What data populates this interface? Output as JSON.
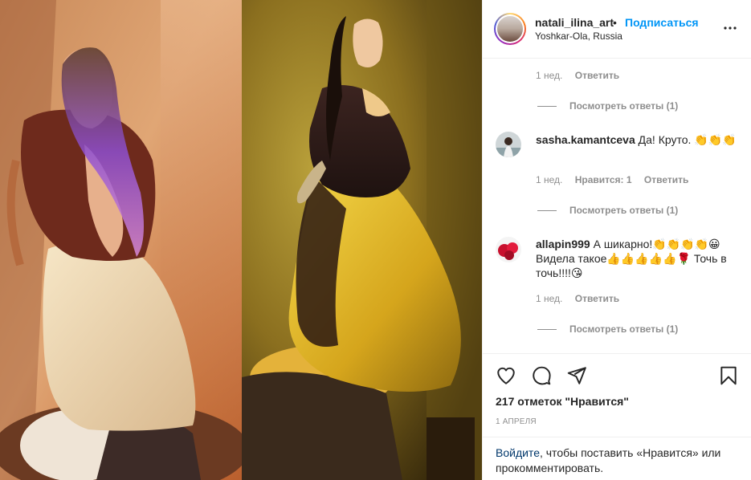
{
  "post": {
    "username": "natali_ilina_art",
    "separator": "•",
    "follow_label": "Подписаться",
    "location": "Yoshkar-Ola, Russia",
    "more_icon": "more-horizontal-icon"
  },
  "comments": [
    {
      "user": "",
      "text": "",
      "time": "1 нед.",
      "likes_label": "",
      "reply_label": "Ответить",
      "view_replies_label": "Посмотреть ответы (1)"
    },
    {
      "user": "sasha.kamantceva",
      "text": "Да! Круто. 👏👏👏",
      "time": "1 нед.",
      "likes_label": "Нравится: 1",
      "reply_label": "Ответить",
      "view_replies_label": "Посмотреть ответы (1)"
    },
    {
      "user": "allapin999",
      "text": "А шикарно!👏👏👏👏😀 Видела такое👍👍👍👍👍🌹 Точь в точь!!!!😘",
      "time": "1 нед.",
      "likes_label": "",
      "reply_label": "Ответить",
      "view_replies_label": "Посмотреть ответы (1)"
    }
  ],
  "actions": {
    "like_icon": "heart-icon",
    "comment_icon": "comment-icon",
    "share_icon": "share-icon",
    "save_icon": "bookmark-icon"
  },
  "likes_text": "217 отметок \"Нравится\"",
  "date_text": "1 апреля",
  "login": {
    "link_label": "Войдите",
    "rest_text": ", чтобы поставить «Нравится» или прокомментировать."
  },
  "colors": {
    "accent": "#0095f6",
    "muted": "#8e8e8e",
    "text": "#262626",
    "border": "#efefef"
  }
}
